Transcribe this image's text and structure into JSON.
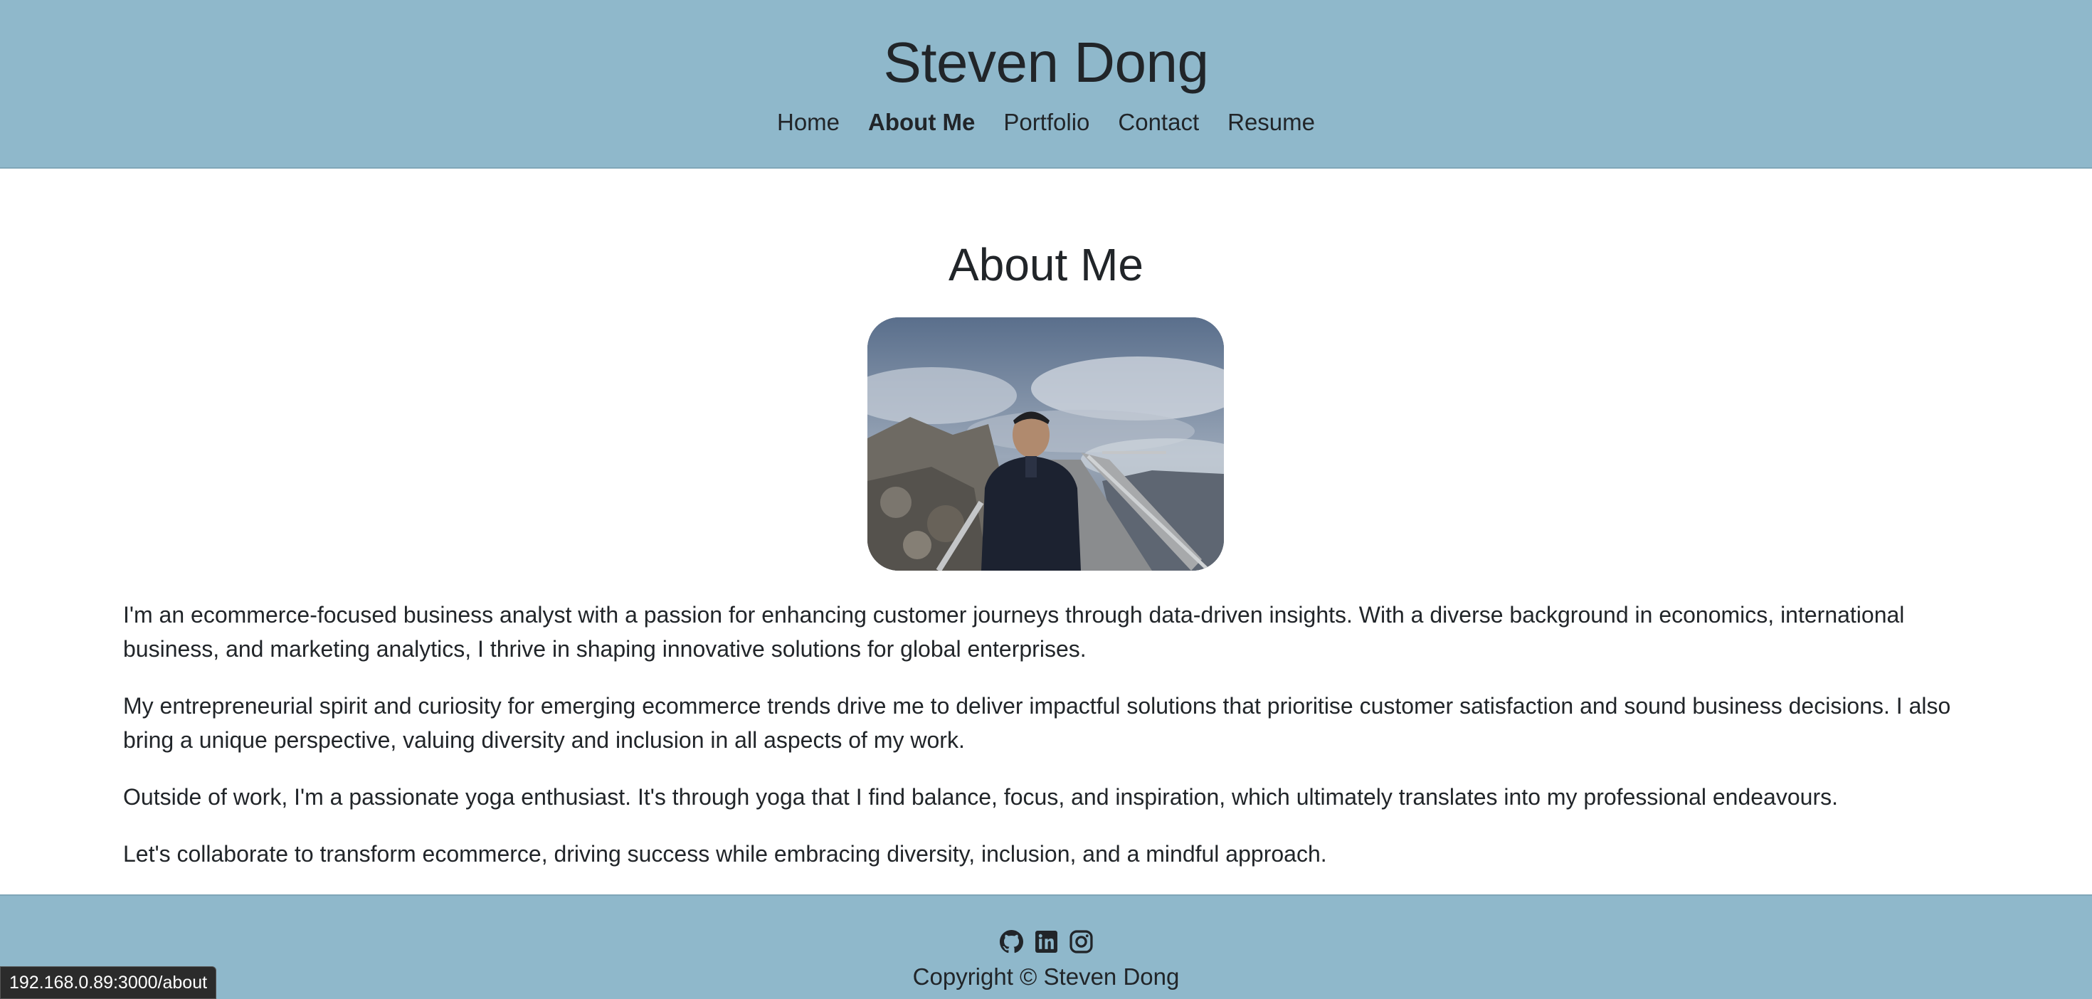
{
  "header": {
    "site_title": "Steven Dong",
    "nav": [
      {
        "label": "Home",
        "active": false
      },
      {
        "label": "About Me",
        "active": true
      },
      {
        "label": "Portfolio",
        "active": false
      },
      {
        "label": "Contact",
        "active": false
      },
      {
        "label": "Resume",
        "active": false
      }
    ]
  },
  "main": {
    "heading": "About Me",
    "photo_alt": "Steven Dong",
    "paragraphs": [
      "I'm an ecommerce-focused business analyst with a passion for enhancing customer journeys through data-driven insights. With a diverse background in economics, international business, and marketing analytics, I thrive in shaping innovative solutions for global enterprises.",
      "My entrepreneurial spirit and curiosity for emerging ecommerce trends drive me to deliver impactful solutions that prioritise customer satisfaction and sound business decisions. I also bring a unique perspective, valuing diversity and inclusion in all aspects of my work.",
      "Outside of work, I'm a passionate yoga enthusiast. It's through yoga that I find balance, focus, and inspiration, which ultimately translates into my professional endeavours.",
      "Let's collaborate to transform ecommerce, driving success while embracing diversity, inclusion, and a mindful approach."
    ]
  },
  "footer": {
    "social_icons": [
      "github-icon",
      "linkedin-icon",
      "instagram-icon"
    ],
    "copyright": "Copyright © Steven Dong"
  },
  "status_bar": {
    "url": "192.168.0.89:3000/about"
  },
  "colors": {
    "header_bg": "#8fb8cb",
    "text": "#212529"
  }
}
